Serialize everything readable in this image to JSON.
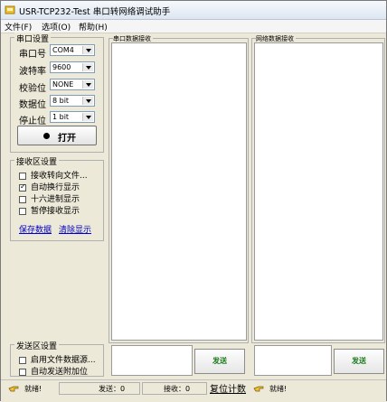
{
  "window": {
    "title": "USR-TCP232-Test 串口转网络调试助手"
  },
  "menu": [
    "文件(F)",
    "选项(O)",
    "帮助(H)"
  ],
  "serial_settings": {
    "title": "串口设置",
    "port_label": "串口号",
    "port_value": "COM4",
    "baud_label": "波特率",
    "baud_value": "9600",
    "parity_label": "校验位",
    "parity_value": "NONE",
    "databits_label": "数据位",
    "databits_value": "8 bit",
    "stopbits_label": "停止位",
    "stopbits_value": "1 bit",
    "open_button": "打开"
  },
  "receive_settings": {
    "title": "接收区设置",
    "options": [
      {
        "label": "接收转向文件...",
        "checked": false
      },
      {
        "label": "自动换行显示",
        "checked": true
      },
      {
        "label": "十六进制显示",
        "checked": false
      },
      {
        "label": "暂停接收显示",
        "checked": false
      }
    ],
    "save_link": "保存数据",
    "clear_link": "清除显示"
  },
  "send_settings": {
    "title": "发送区设置",
    "options": [
      {
        "label": "启用文件数据源...",
        "checked": false
      },
      {
        "label": "自动发送附加位",
        "checked": false
      }
    ]
  },
  "serial_receive_title": "串口数据接收",
  "network_receive_title": "网络数据接收",
  "send_button_left": "发送",
  "send_button_right": "发送",
  "status": {
    "ready_left": "就绪!",
    "sent": "发送：0",
    "received": "接收：0",
    "reset": "复位计数",
    "ready_right": "就绪!"
  }
}
